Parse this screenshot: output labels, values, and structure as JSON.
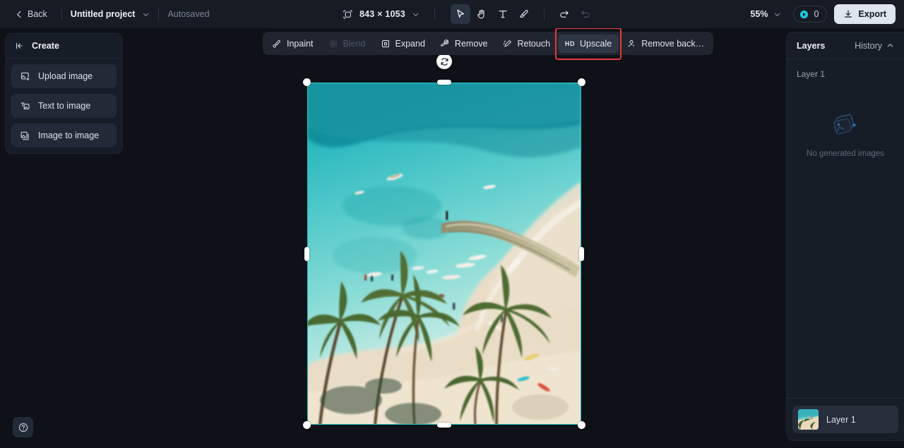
{
  "topbar": {
    "back_label": "Back",
    "project_name": "Untitled project",
    "autosave_label": "Autosaved",
    "canvas_size": "843 × 1053",
    "zoom_level": "55%",
    "credits_count": "0",
    "export_label": "Export",
    "tools": [
      {
        "name": "select-tool",
        "icon": "cursor-icon",
        "active": true
      },
      {
        "name": "hand-tool",
        "icon": "hand-icon",
        "active": false
      },
      {
        "name": "text-tool",
        "icon": "text-icon",
        "active": false
      },
      {
        "name": "brush-tool",
        "icon": "brush-icon",
        "active": false
      }
    ],
    "undo_label": "Undo",
    "redo_label": "Redo"
  },
  "create_panel": {
    "title": "Create",
    "collapse_icon": "collapse-left-icon",
    "items": [
      {
        "label": "Upload image",
        "icon": "upload-image-icon"
      },
      {
        "label": "Text to image",
        "icon": "text-to-image-icon"
      },
      {
        "label": "Image to image",
        "icon": "image-to-image-icon"
      }
    ]
  },
  "action_bar": {
    "items": [
      {
        "label": "Inpaint",
        "icon": "inpaint-icon",
        "disabled": false,
        "selected": false
      },
      {
        "label": "Blend",
        "icon": "blend-icon",
        "disabled": true,
        "selected": false
      },
      {
        "label": "Expand",
        "icon": "expand-icon",
        "disabled": false,
        "selected": false
      },
      {
        "label": "Remove",
        "icon": "remove-icon",
        "disabled": false,
        "selected": false
      },
      {
        "label": "Retouch",
        "icon": "retouch-icon",
        "disabled": false,
        "selected": false
      },
      {
        "label": "Upscale",
        "icon": "hd-icon",
        "disabled": false,
        "selected": true,
        "highlighted": true
      },
      {
        "label": "Remove back…",
        "icon": "remove-background-icon",
        "disabled": false,
        "selected": false
      }
    ]
  },
  "canvas": {
    "rotate_handle_icon": "rotate-icon",
    "selection_color": "#1fc3c9",
    "image_description": "Aerial beach scene with turquoise water, boats, stone jetty and palm trees"
  },
  "right_panel": {
    "title": "Layers",
    "history_label": "History",
    "history_chevron": "chevron-up-icon",
    "layer_group_label": "Layer 1",
    "empty_state": {
      "icon": "stacked-images-icon",
      "text": "No generated images"
    },
    "layers": [
      {
        "name": "Layer 1",
        "thumb": "beach-thumbnail"
      }
    ]
  },
  "help": {
    "icon": "question-mark-icon",
    "label": "Help"
  }
}
